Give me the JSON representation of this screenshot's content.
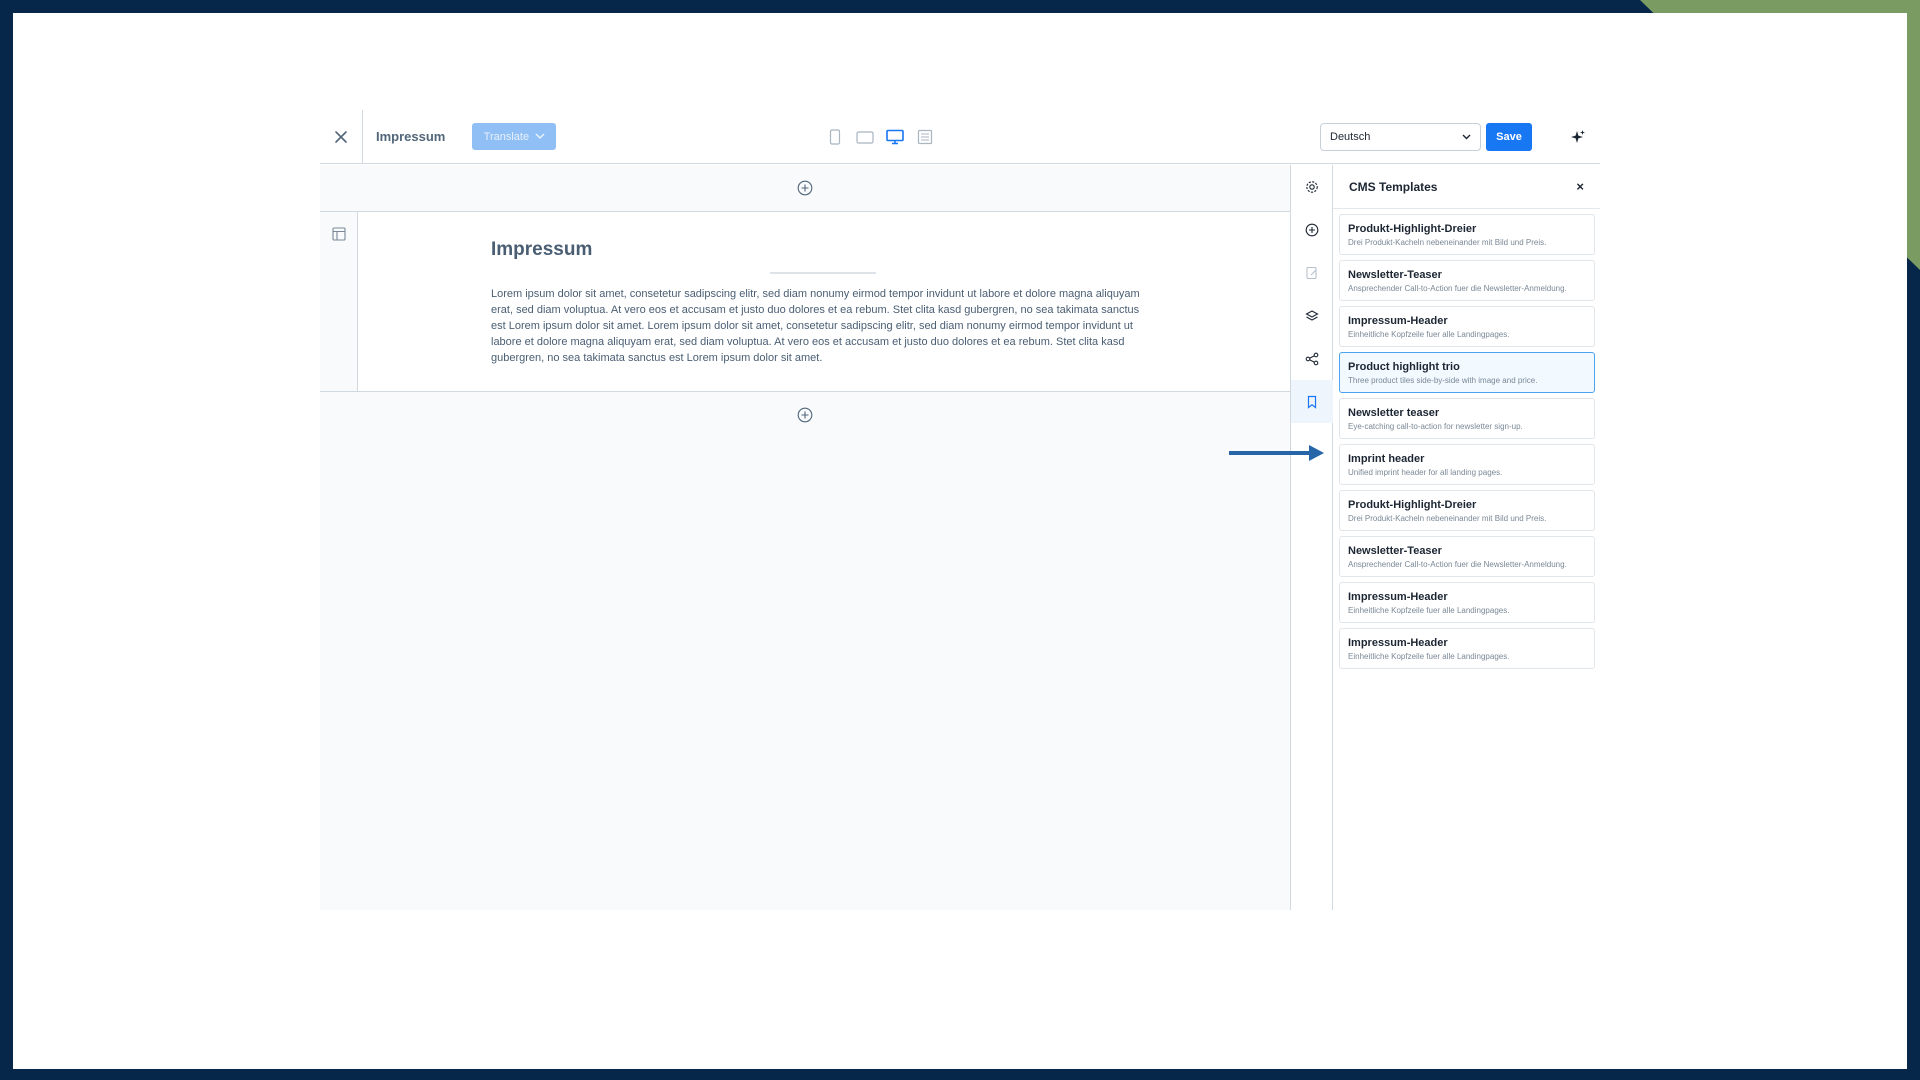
{
  "header": {
    "page_name": "Impressum",
    "translate_label": "Translate",
    "language": "Deutsch",
    "save_label": "Save"
  },
  "content": {
    "title": "Impressum",
    "body": "Lorem ipsum dolor sit amet, consetetur sadipscing elitr, sed diam nonumy eirmod tempor invidunt ut labore et dolore magna aliquyam erat, sed diam voluptua. At vero eos et accusam et justo duo dolores et ea rebum. Stet clita kasd gubergren, no sea takimata sanctus est Lorem ipsum dolor sit amet. Lorem ipsum dolor sit amet, consetetur sadipscing elitr, sed diam nonumy eirmod tempor invidunt ut labore et dolore magna aliquyam erat, sed diam voluptua. At vero eos et accusam et justo duo dolores et ea rebum. Stet clita kasd gubergren, no sea takimata sanctus est Lorem ipsum dolor sit amet."
  },
  "panel": {
    "title": "CMS Templates",
    "close_label": "×",
    "templates": [
      {
        "name": "Produkt-Highlight-Dreier",
        "desc": "Drei Produkt-Kacheln nebeneinander mit Bild und Preis."
      },
      {
        "name": "Newsletter-Teaser",
        "desc": "Ansprechender Call-to-Action fuer die Newsletter-Anmeldung."
      },
      {
        "name": "Impressum-Header",
        "desc": "Einheitliche Kopfzeile fuer alle Landingpages."
      },
      {
        "name": "Product highlight trio",
        "desc": "Three product tiles side-by-side with image and price."
      },
      {
        "name": "Newsletter teaser",
        "desc": "Eye-catching call-to-action for newsletter sign-up."
      },
      {
        "name": "Imprint header",
        "desc": "Unified imprint header for all landing pages."
      },
      {
        "name": "Produkt-Highlight-Dreier",
        "desc": "Drei Produkt-Kacheln nebeneinander mit Bild und Preis."
      },
      {
        "name": "Newsletter-Teaser",
        "desc": "Ansprechender Call-to-Action fuer die Newsletter-Anmeldung."
      },
      {
        "name": "Impressum-Header",
        "desc": "Einheitliche Kopfzeile fuer alle Landingpages."
      },
      {
        "name": "Impressum-Header",
        "desc": "Einheitliche Kopfzeile fuer alle Landingpages."
      }
    ],
    "selected_index": 3
  },
  "colors": {
    "accent": "#1877f2",
    "translate_button": "#8fbff4",
    "selected_border": "#4aa3f0",
    "arrow": "#2565a8"
  },
  "icons": [
    "close-icon",
    "chevron-down-icon",
    "mobile-icon",
    "tablet-icon",
    "desktop-icon",
    "list-view-icon",
    "ai-sparkle-icon",
    "plus-circle-icon",
    "layout-icon",
    "settings-icon",
    "edit-icon",
    "layers-icon",
    "share-icon",
    "bookmark-icon"
  ]
}
